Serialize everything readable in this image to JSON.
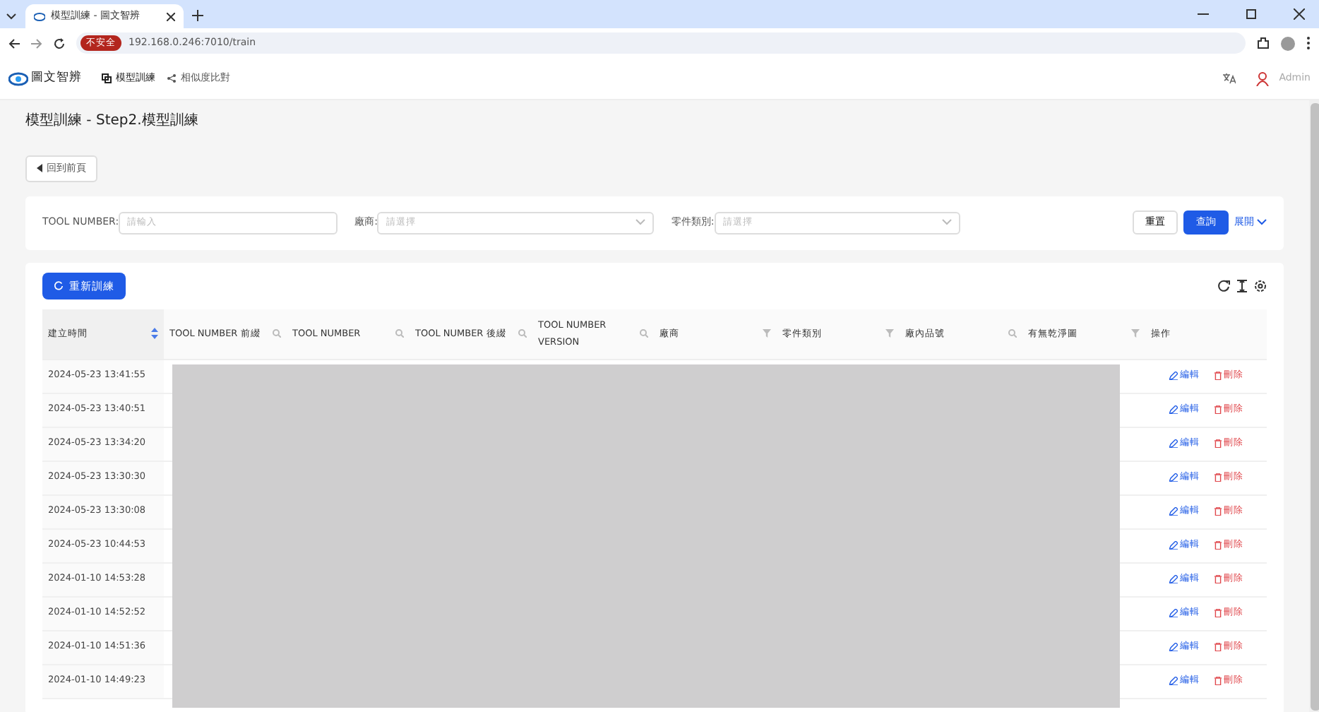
{
  "browser": {
    "tab_title": "模型訓練 - 圖文智辨",
    "security": "不安全",
    "url": "192.168.0.246:7010/train"
  },
  "app_nav": {
    "brand": "圖文智辨",
    "items": [
      {
        "label": "模型訓練",
        "selected": true
      },
      {
        "label": "相似度比對",
        "selected": false
      }
    ],
    "user": "Admin"
  },
  "page_title": "模型訓練 - Step2.模型訓練",
  "back_button": "回到前頁",
  "filters": [
    {
      "label": "TOOL NUMBER:",
      "placeholder": "請輸入",
      "kind": "input"
    },
    {
      "label": "廠商:",
      "placeholder": "請選擇",
      "kind": "select"
    },
    {
      "label": "零件類別:",
      "placeholder": "請選擇",
      "kind": "select"
    }
  ],
  "filter_buttons": {
    "reset": "重置",
    "query": "查詢",
    "expand": "展開"
  },
  "retrain_button": "重新訓練",
  "table": {
    "columns": [
      {
        "label": "建立時間",
        "kind": "sortable"
      },
      {
        "label": "TOOL NUMBER 前綴",
        "kind": "searchable"
      },
      {
        "label": "TOOL NUMBER",
        "kind": "searchable"
      },
      {
        "label": "TOOL NUMBER 後綴",
        "kind": "searchable"
      },
      {
        "label": "TOOL NUMBER VERSION",
        "kind": "searchable"
      },
      {
        "label": "廠商",
        "kind": "filterable"
      },
      {
        "label": "零件類別",
        "kind": "filterable"
      },
      {
        "label": "廠內品號",
        "kind": "searchable"
      },
      {
        "label": "有無乾淨圖",
        "kind": "filterable"
      },
      {
        "label": "操作",
        "kind": "plain"
      }
    ],
    "rows": [
      {
        "created": "2024-05-23 13:41:55",
        "edit": "編輯",
        "delete": "刪除"
      },
      {
        "created": "2024-05-23 13:40:51",
        "edit": "編輯",
        "delete": "刪除"
      },
      {
        "created": "2024-05-23 13:34:20",
        "edit": "編輯",
        "delete": "刪除"
      },
      {
        "created": "2024-05-23 13:30:30",
        "edit": "編輯",
        "delete": "刪除"
      },
      {
        "created": "2024-05-23 13:30:08",
        "edit": "編輯",
        "delete": "刪除"
      },
      {
        "created": "2024-05-23 10:44:53",
        "edit": "編輯",
        "delete": "刪除"
      },
      {
        "created": "2024-01-10 14:53:28",
        "edit": "編輯",
        "delete": "刪除"
      },
      {
        "created": "2024-01-10 14:52:52",
        "edit": "編輯",
        "delete": "刪除"
      },
      {
        "created": "2024-01-10 14:51:36",
        "edit": "編輯",
        "delete": "刪除"
      },
      {
        "created": "2024-01-10 14:49:23",
        "edit": "編輯",
        "delete": "刪除"
      }
    ]
  }
}
